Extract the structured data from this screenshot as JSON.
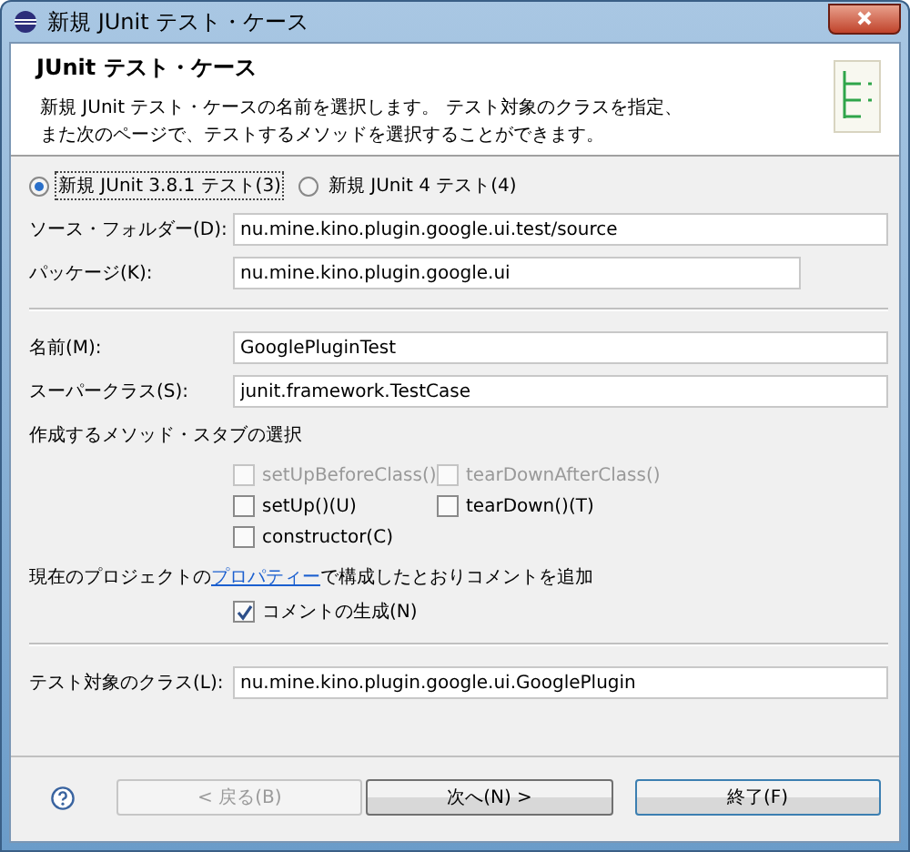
{
  "window": {
    "title": "新規 JUnit テスト・ケース"
  },
  "header": {
    "title": "JUnit テスト・ケース",
    "description": [
      "新規 JUnit テスト・ケースの名前を選択します。 テスト対象のクラスを指定、",
      "また次のページで、テストするメソッドを選択することができます。"
    ]
  },
  "test_versions": [
    {
      "label": "新規 JUnit 3.8.1 テスト(3)",
      "selected": true
    },
    {
      "label": "新規 JUnit 4 テスト(4)",
      "selected": false
    }
  ],
  "location_fields": [
    {
      "label": "ソース・フォルダー(D):",
      "value": "nu.mine.kino.plugin.google.ui.test/source",
      "wide": true
    },
    {
      "label": "パッケージ(K):",
      "value": "nu.mine.kino.plugin.google.ui",
      "wide": false
    }
  ],
  "class_fields": [
    {
      "label": "名前(M):",
      "value": "GooglePluginTest"
    },
    {
      "label": "スーパークラス(S):",
      "value": "junit.framework.TestCase"
    }
  ],
  "stubs": {
    "heading": "作成するメソッド・スタブの選択",
    "options": [
      {
        "label": "setUpBeforeClass()",
        "checked": false,
        "disabled": true
      },
      {
        "label": "tearDownAfterClass()",
        "checked": false,
        "disabled": true
      },
      {
        "label": "setUp()(U)",
        "checked": false,
        "disabled": false
      },
      {
        "label": "tearDown()(T)",
        "checked": false,
        "disabled": false
      },
      {
        "label": "constructor(C)",
        "checked": false,
        "disabled": false
      }
    ]
  },
  "comments": {
    "before": "現在のプロジェクトの",
    "link": "プロパティー",
    "after": "で構成したとおりコメントを追加",
    "option": {
      "label": "コメントの生成(N)",
      "checked": true,
      "disabled": false
    }
  },
  "target_field": {
    "label": "テスト対象のクラス(L):",
    "value": "nu.mine.kino.plugin.google.ui.GooglePlugin"
  },
  "buttons": [
    {
      "label": "< 戻る(B)",
      "disabled": true,
      "default": false
    },
    {
      "label": "次へ(N) >",
      "disabled": false,
      "default": false
    },
    {
      "label": "終了(F)",
      "disabled": false,
      "default": true
    }
  ]
}
